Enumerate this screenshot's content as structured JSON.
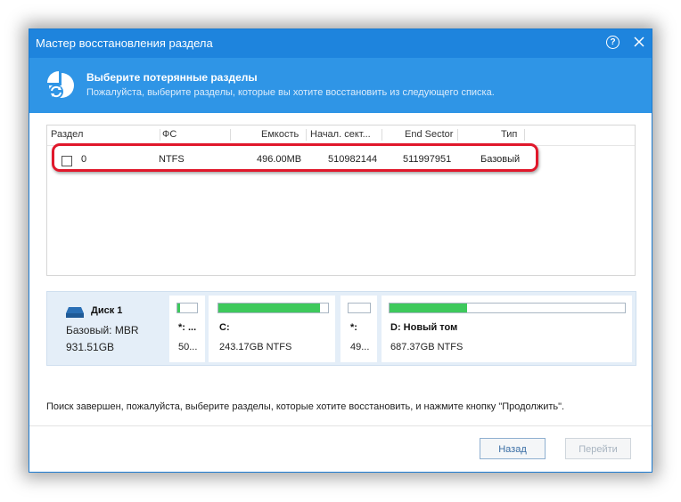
{
  "window": {
    "title": "Мастер восстановления раздела",
    "help_symbol": "?"
  },
  "header": {
    "title": "Выберите потерянные разделы",
    "subtitle": "Пожалуйста, выберите разделы, которые вы хотите восстановить из следующего списка."
  },
  "table": {
    "columns": [
      "Раздел",
      "ФС",
      "Емкость",
      "Начал. сект...",
      "End Sector",
      "Тип"
    ],
    "rows": [
      {
        "checked": false,
        "partition": "0",
        "fs": "NTFS",
        "capacity": "496.00MB",
        "start_sector": "510982144",
        "end_sector": "511997951",
        "type": "Базовый"
      }
    ]
  },
  "disk": {
    "name": "Диск 1",
    "type": "Базовый: MBR",
    "size": "931.51GB",
    "partitions": [
      {
        "label": "*: ...",
        "info": "50...",
        "used_fraction": 0.15
      },
      {
        "label": "C:",
        "info": "243.17GB NTFS",
        "used_fraction": 0.93
      },
      {
        "label": "*:",
        "info": "49...",
        "used_fraction": 0.0
      },
      {
        "label": "D: Новый том",
        "info": "687.37GB NTFS",
        "used_fraction": 0.33
      }
    ]
  },
  "status_text": "Поиск завершен, пожалуйста, выберите разделы, которые хотите восстановить, и нажмите кнопку \"Продолжить\".",
  "buttons": {
    "back": "Назад",
    "proceed": "Перейти"
  },
  "colors": {
    "titlebar": "#1e84dd",
    "header": "#2f95e6",
    "highlight": "#e0182b",
    "used_bar": "#3ec95c"
  }
}
